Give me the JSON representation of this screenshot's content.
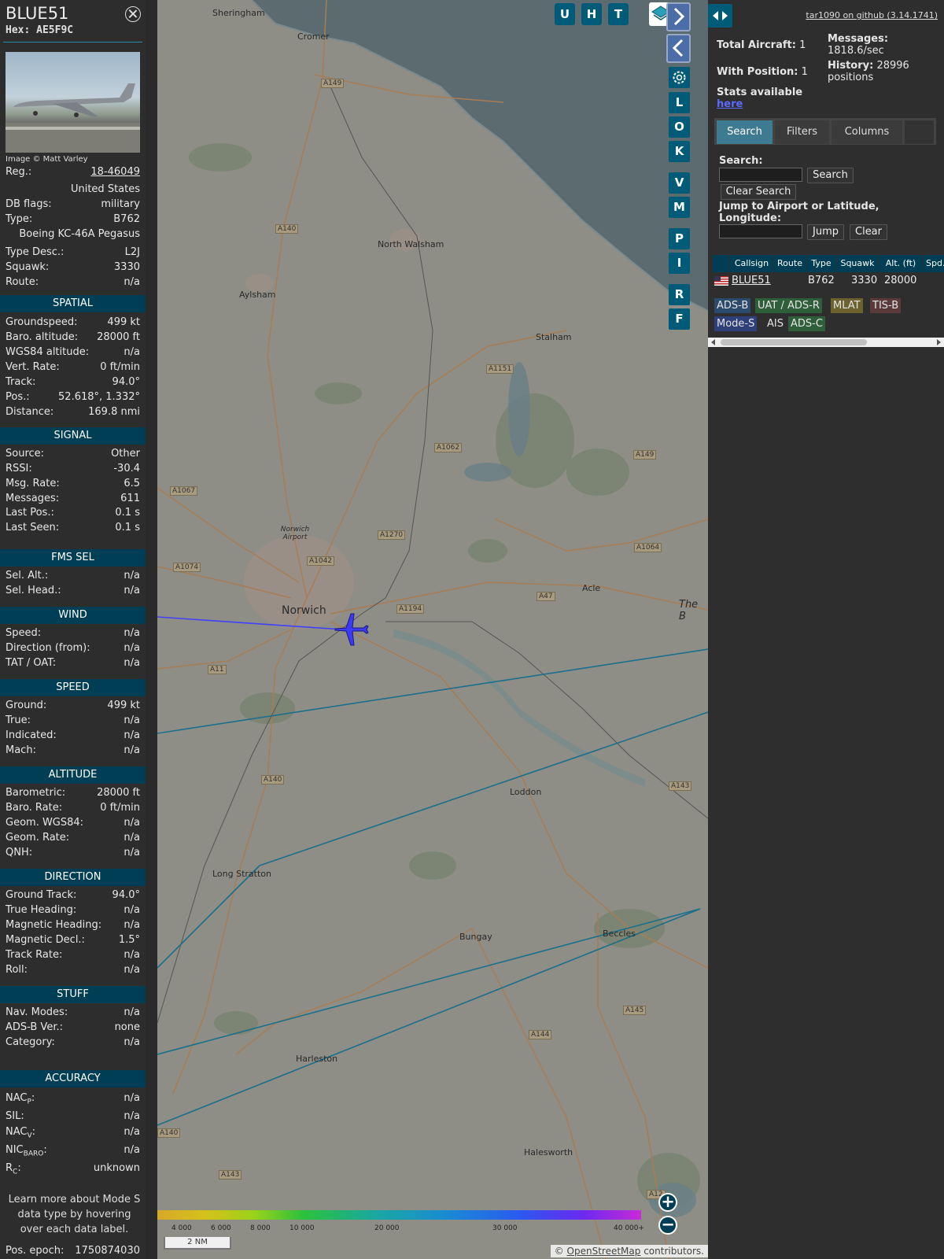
{
  "info": {
    "callsign": "BLUE51",
    "hex": "Hex: AE5F9C",
    "photo_credit": "Image © Matt Varley",
    "reg_label": "Reg.:",
    "reg_value": "18-46049",
    "country": "United States",
    "db_flags_label": "DB flags:",
    "db_flags_value": "military",
    "type_label": "Type:",
    "type_value": "B762",
    "type_name": "Boeing KC-46A Pegasus",
    "type_desc_label": "Type Desc.:",
    "type_desc_value": "L2J",
    "squawk_label": "Squawk:",
    "squawk_value": "3330",
    "route_label": "Route:",
    "route_value": "n/a",
    "sections": {
      "spatial": "SPATIAL",
      "signal": "SIGNAL",
      "fms": "FMS SEL",
      "wind": "WIND",
      "speed": "SPEED",
      "altitude": "ALTITUDE",
      "direction": "DIRECTION",
      "stuff": "STUFF",
      "accuracy": "ACCURACY"
    },
    "spatial": [
      {
        "k": "Groundspeed:",
        "v": "499 kt"
      },
      {
        "k": "Baro. altitude:",
        "v": "28000 ft"
      },
      {
        "k": "WGS84 altitude:",
        "v": "n/a"
      },
      {
        "k": "Vert. Rate:",
        "v": "0 ft/min"
      },
      {
        "k": "Track:",
        "v": "94.0°"
      },
      {
        "k": "Pos.:",
        "v": "52.618°, 1.332°"
      },
      {
        "k": "Distance:",
        "v": "169.8 nmi"
      }
    ],
    "signal": [
      {
        "k": "Source:",
        "v": "Other"
      },
      {
        "k": "RSSI:",
        "v": "-30.4"
      },
      {
        "k": "Msg. Rate:",
        "v": "6.5"
      },
      {
        "k": "Messages:",
        "v": "611"
      },
      {
        "k": "Last Pos.:",
        "v": "0.1 s"
      },
      {
        "k": "Last Seen:",
        "v": "0.1 s"
      }
    ],
    "fms": [
      {
        "k": "Sel. Alt.:",
        "v": "n/a"
      },
      {
        "k": "Sel. Head.:",
        "v": "n/a"
      }
    ],
    "wind": [
      {
        "k": "Speed:",
        "v": "n/a"
      },
      {
        "k": "Direction (from):",
        "v": "n/a"
      },
      {
        "k": "TAT / OAT:",
        "v": "n/a"
      }
    ],
    "speed": [
      {
        "k": "Ground:",
        "v": "499 kt"
      },
      {
        "k": "True:",
        "v": "n/a"
      },
      {
        "k": "Indicated:",
        "v": "n/a"
      },
      {
        "k": "Mach:",
        "v": "n/a"
      }
    ],
    "altitude": [
      {
        "k": "Barometric:",
        "v": "28000 ft"
      },
      {
        "k": "Baro. Rate:",
        "v": "0 ft/min"
      },
      {
        "k": "Geom. WGS84:",
        "v": "n/a"
      },
      {
        "k": "Geom. Rate:",
        "v": "n/a"
      },
      {
        "k": "QNH:",
        "v": "n/a"
      }
    ],
    "direction": [
      {
        "k": "Ground Track:",
        "v": "94.0°"
      },
      {
        "k": "True Heading:",
        "v": "n/a"
      },
      {
        "k": "Magnetic Heading:",
        "v": "n/a"
      },
      {
        "k": "Magnetic Decl.:",
        "v": "1.5°"
      },
      {
        "k": "Track Rate:",
        "v": "n/a"
      },
      {
        "k": "Roll:",
        "v": "n/a"
      }
    ],
    "stuff": [
      {
        "k": "Nav. Modes:",
        "v": "n/a"
      },
      {
        "k": "ADS-B Ver.:",
        "v": "none"
      },
      {
        "k": "Category:",
        "v": "n/a"
      }
    ],
    "accuracy": {
      "nacp_k": "NAC",
      "nacp_sub": "P",
      "nacp_v": "n/a",
      "sil_k": "SIL:",
      "sil_v": "n/a",
      "nacv_k": "NAC",
      "nacv_sub": "V",
      "nacv_v": "n/a",
      "nic_k": "NIC",
      "nic_sub": "BARO",
      "nic_v": "n/a",
      "rc_k": "R",
      "rc_sub": "C",
      "rc_v": "unknown"
    },
    "note": "Learn more about Mode S data type by hovering over each data label.",
    "pos_epoch_label": "Pos. epoch:",
    "pos_epoch_value": "1750874030"
  },
  "map": {
    "buttons_top": [
      "U",
      "H",
      "T"
    ],
    "buttons_side": [
      "L",
      "O",
      "K",
      "V",
      "M",
      "P",
      "I",
      "R",
      "F"
    ],
    "places": [
      {
        "name": "Sheringham"
      },
      {
        "name": "Cromer"
      },
      {
        "name": "North Walsham"
      },
      {
        "name": "Aylsham"
      },
      {
        "name": "Stalham"
      },
      {
        "name": "Norwich"
      },
      {
        "name": "Norwich Airport"
      },
      {
        "name": "Acle"
      },
      {
        "name": "The B"
      },
      {
        "name": "Loddon"
      },
      {
        "name": "Long Stratton"
      },
      {
        "name": "Bungay"
      },
      {
        "name": "Beccles"
      },
      {
        "name": "Harleston"
      },
      {
        "name": "Halesworth"
      }
    ],
    "roads": [
      "A149",
      "A140",
      "A1151",
      "A1062",
      "A149",
      "A1067",
      "A1270",
      "A1064",
      "A1074",
      "A1042",
      "A47",
      "A1194",
      "A11",
      "A140",
      "A143",
      "A145",
      "A144",
      "A140",
      "A143",
      "A12"
    ],
    "color_scale": [
      "4 000",
      "6 000",
      "8 000",
      "10 000",
      "20 000",
      "30 000",
      "40 000+"
    ],
    "scale_label": "2 NM",
    "attribution_prefix": "© ",
    "attribution_link": "OpenStreetMap",
    "attribution_suffix": " contributors."
  },
  "right": {
    "github": "tar1090 on github (3.14.1741)",
    "total_aircraft": "Total Aircraft:",
    "total_aircraft_v": "1",
    "messages_label": "Messages:",
    "messages_v": "1818.6/sec",
    "with_position": "With Position:",
    "with_position_v": "1",
    "history_label": "History:",
    "history_v": "28996 positions",
    "stats_text": "Stats available",
    "stats_link": "here",
    "tabs": [
      "Search",
      "Filters",
      "Columns"
    ],
    "search_label": "Search:",
    "search_button": "Search",
    "clear_search_button": "Clear Search",
    "jump_label": "Jump to Airport or Latitude, Longitude:",
    "jump_button": "Jump",
    "clear_button": "Clear",
    "columns": [
      "Callsign",
      "Route",
      "Type",
      "Squawk",
      "Alt. (ft)",
      "Spd."
    ],
    "rows": [
      {
        "callsign": "BLUE51",
        "route": "",
        "type": "B762",
        "squawk": "3330",
        "alt": "28000"
      }
    ],
    "sources": [
      {
        "label": "ADS-B",
        "color": "#2c4a6b"
      },
      {
        "label": "UAT / ADS-R",
        "color": "#2f5e3a"
      },
      {
        "label": "MLAT",
        "color": "#6b6230"
      },
      {
        "label": "TIS-B",
        "color": "#5a3a3a"
      },
      {
        "label": "Mode-S",
        "color": "#2f3f7a"
      },
      {
        "label": "AIS",
        "color": "#2e2e2e"
      },
      {
        "label": "ADS-C",
        "color": "#2f5e3a"
      }
    ]
  }
}
